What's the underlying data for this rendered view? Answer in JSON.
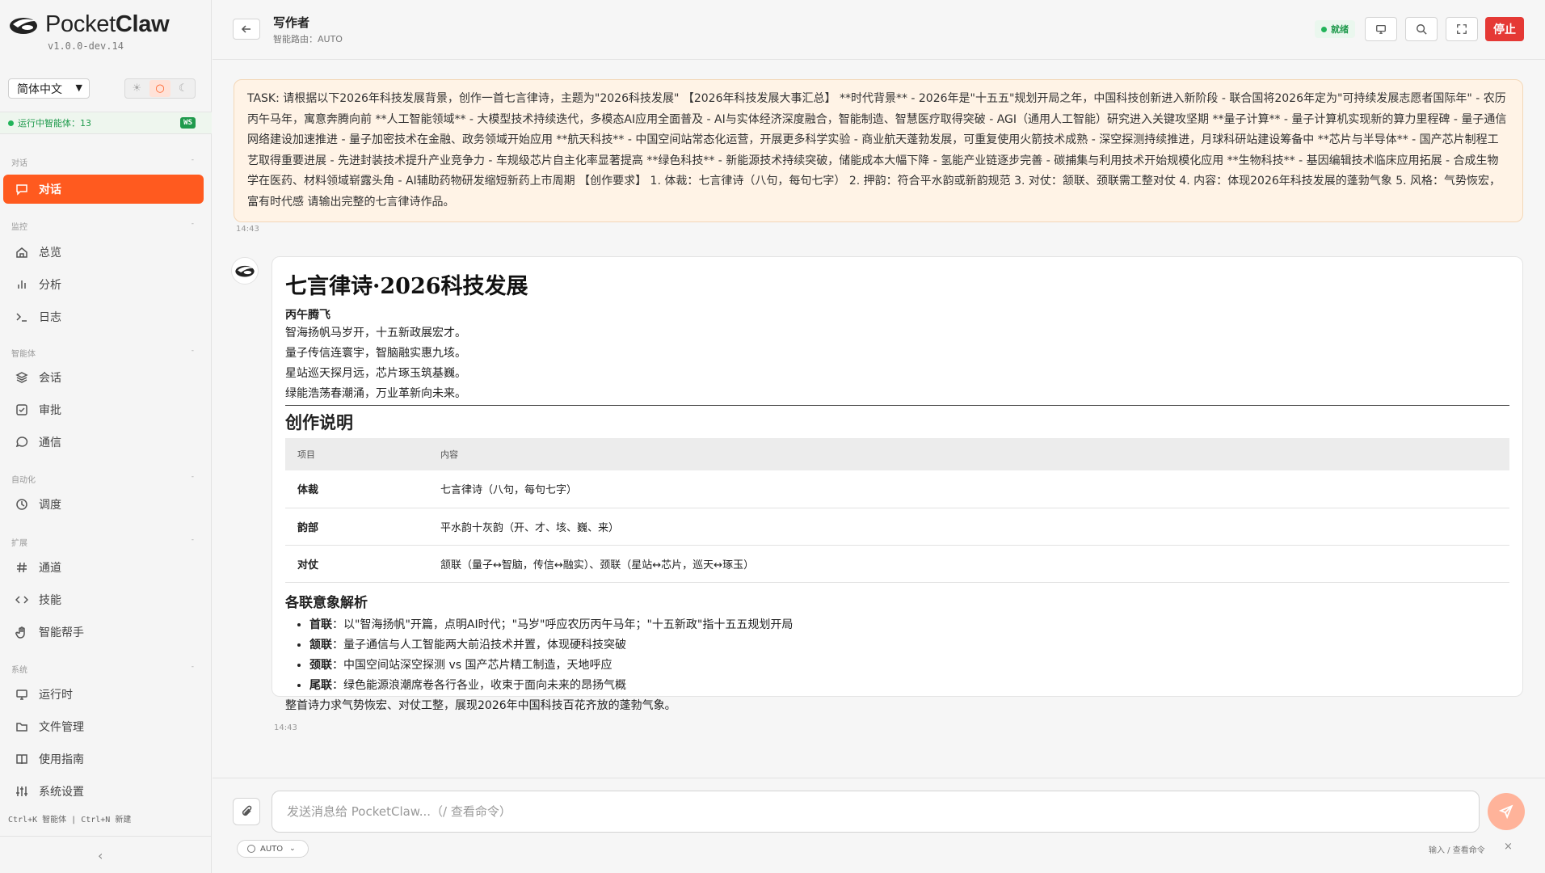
{
  "brand": {
    "name_part1": "Pocket",
    "name_part2": "Claw",
    "version": "v1.0.0-dev.14"
  },
  "language": {
    "selected": "简体中文"
  },
  "runtime": {
    "status_text": "运行中智能体：13",
    "badge": "WS"
  },
  "sidebar": {
    "sections": [
      {
        "label": "对话"
      },
      {
        "label": "监控"
      },
      {
        "label": "智能体"
      },
      {
        "label": "自动化"
      },
      {
        "label": "扩展"
      },
      {
        "label": "系统"
      }
    ],
    "items": [
      {
        "label": "对话",
        "icon": "chat-icon"
      },
      {
        "label": "总览",
        "icon": "home-icon"
      },
      {
        "label": "分析",
        "icon": "bar-chart-icon"
      },
      {
        "label": "日志",
        "icon": "terminal-icon"
      },
      {
        "label": "会话",
        "icon": "layers-icon"
      },
      {
        "label": "审批",
        "icon": "check-square-icon"
      },
      {
        "label": "通信",
        "icon": "message-icon"
      },
      {
        "label": "调度",
        "icon": "clock-icon"
      },
      {
        "label": "通道",
        "icon": "hash-icon"
      },
      {
        "label": "技能",
        "icon": "code-icon"
      },
      {
        "label": "智能帮手",
        "icon": "hand-icon"
      },
      {
        "label": "运行时",
        "icon": "monitor-icon"
      },
      {
        "label": "文件管理",
        "icon": "folder-icon"
      },
      {
        "label": "使用指南",
        "icon": "book-icon"
      },
      {
        "label": "系统设置",
        "icon": "sliders-icon"
      }
    ],
    "shortcuts": "Ctrl+K 智能体 | Ctrl+N 新建"
  },
  "header": {
    "title": "写作者",
    "subtitle": "智能路由：AUTO",
    "status": "就绪",
    "stop_label": "停止"
  },
  "chat": {
    "task_text": "TASK: 请根据以下2026年科技发展背景，创作一首七言律诗，主题为\"2026科技发展\" 【2026年科技发展大事汇总】 **时代背景** - 2026年是\"十五五\"规划开局之年，中国科技创新进入新阶段 - 联合国将2026年定为\"可持续发展志愿者国际年\" - 农历丙午马年，寓意奔腾向前 **人工智能领域** - 大模型技术持续迭代，多模态AI应用全面普及 - AI与实体经济深度融合，智能制造、智慧医疗取得突破 - AGI（通用人工智能）研究进入关键攻坚期 **量子计算** - 量子计算机实现新的算力里程碑 - 量子通信网络建设加速推进 - 量子加密技术在金融、政务领域开始应用 **航天科技** - 中国空间站常态化运营，开展更多科学实验 - 商业航天蓬勃发展，可重复使用火箭技术成熟 - 深空探测持续推进，月球科研站建设筹备中 **芯片与半导体** - 国产芯片制程工艺取得重要进展 - 先进封装技术提升产业竞争力 - 车规级芯片自主化率显著提高 **绿色科技** - 新能源技术持续突破，储能成本大幅下降 - 氢能产业链逐步完善 - 碳捕集与利用技术开始规模化应用 **生物科技** - 基因编辑技术临床应用拓展 - 合成生物学在医药、材料领域崭露头角 - AI辅助药物研发缩短新药上市周期 【创作要求】 1. 体裁：七言律诗（八句，每句七字） 2. 押韵：符合平水韵或新韵规范 3. 对仗：颔联、颈联需工整对仗 4. 内容：体现2026年科技发展的蓬勃气象 5. 风格：气势恢宏，富有时代感 请输出完整的七言律诗作品。",
    "task_time": "14:43",
    "reply_time": "14:43",
    "reply": {
      "title": "七言律诗·2026科技发展",
      "poem_subtitle": "丙午腾飞",
      "poem_lines": [
        "智海扬帆马岁开，十五新政展宏才。",
        "量子传信连寰宇，智脑融实惠九垓。",
        "星站巡天探月远，芯片琢玉筑基巍。",
        "绿能浩荡春潮涌，万业革新向未来。"
      ],
      "notes_heading": "创作说明",
      "table": {
        "headers": [
          "项目",
          "内容"
        ],
        "rows": [
          [
            "体裁",
            "七言律诗（八句，每句七字）"
          ],
          [
            "韵部",
            "平水韵十灰韵（开、才、垓、巍、来）"
          ],
          [
            "对仗",
            "颔联（量子↔智脑，传信↔融实）、颈联（星站↔芯片，巡天↔琢玉）"
          ]
        ]
      },
      "analysis_heading": "各联意象解析",
      "analysis": [
        {
          "term": "首联",
          "text": "：以\"智海扬帆\"开篇，点明AI时代；\"马岁\"呼应农历丙午马年；\"十五新政\"指十五五规划开局"
        },
        {
          "term": "颔联",
          "text": "：量子通信与人工智能两大前沿技术并置，体现硬科技突破"
        },
        {
          "term": "颈联",
          "text": "：中国空间站深空探测 vs 国产芯片精工制造，天地呼应"
        },
        {
          "term": "尾联",
          "text": "：绿色能源浪潮席卷各行各业，收束于面向未来的昂扬气概"
        }
      ],
      "summary": "整首诗力求气势恢宏、对仗工整，展现2026年中国科技百花齐放的蓬勃气象。"
    }
  },
  "input": {
    "placeholder": "发送消息给 PocketClaw...（/ 查看命令）",
    "mode": "AUTO",
    "hint": "输入 / 查看命令"
  },
  "colors": {
    "accent": "#ff5a1f",
    "stop": "#e53935",
    "ok": "#22b45a"
  }
}
